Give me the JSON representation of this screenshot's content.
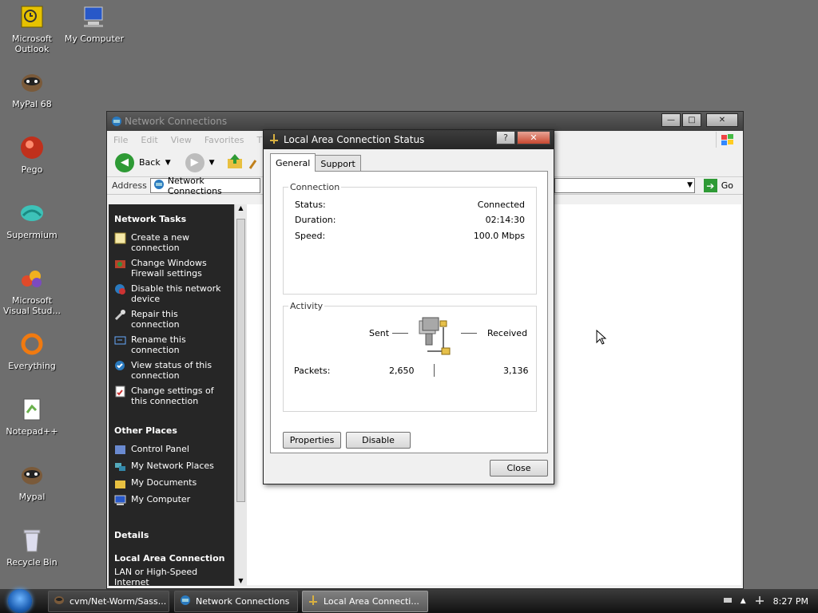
{
  "desktop": {
    "icons": [
      {
        "label": "Microsoft Outlook",
        "icon": "outlook-icon"
      },
      {
        "label": "My Computer",
        "icon": "my-computer-icon"
      },
      {
        "label": "MyPal 68",
        "icon": "mypal-icon"
      },
      {
        "label": "Pego",
        "icon": "pego-icon"
      },
      {
        "label": "Supermium",
        "icon": "supermium-icon"
      },
      {
        "label": "Microsoft Visual Stud...",
        "icon": "visual-studio-icon"
      },
      {
        "label": "Everything",
        "icon": "everything-icon"
      },
      {
        "label": "Notepad++",
        "icon": "notepadpp-icon"
      },
      {
        "label": "Mypal",
        "icon": "mypal-icon"
      },
      {
        "label": "Recycle Bin",
        "icon": "recycle-bin-icon"
      }
    ]
  },
  "nc_window": {
    "title": "Network Connections",
    "menu": [
      "File",
      "Edit",
      "View",
      "Favorites",
      "T"
    ],
    "toolbar": {
      "back": "Back"
    },
    "address": {
      "label": "Address",
      "value": "Network Connections",
      "go": "Go"
    },
    "tasks": {
      "heading": "Network Tasks",
      "items": [
        "Create a new connection",
        "Change Windows Firewall settings",
        "Disable this network device",
        "Repair this connection",
        "Rename this connection",
        "View status of this connection",
        "Change settings of this connection"
      ]
    },
    "other_places": {
      "heading": "Other Places",
      "items": [
        "Control Panel",
        "My Network Places",
        "My Documents",
        "My Computer"
      ]
    },
    "details": {
      "heading": "Details",
      "name": "Local Area Connection",
      "desc": "LAN or High-Speed Internet"
    }
  },
  "dialog": {
    "title": "Local Area Connection Status",
    "help_btn": "?",
    "close_btn": "✕",
    "tabs": [
      "General",
      "Support"
    ],
    "connection": {
      "heading": "Connection",
      "rows": [
        {
          "label": "Status:",
          "value": "Connected"
        },
        {
          "label": "Duration:",
          "value": "02:14:30"
        },
        {
          "label": "Speed:",
          "value": "100.0 Mbps"
        }
      ]
    },
    "activity": {
      "heading": "Activity",
      "sent_label": "Sent",
      "received_label": "Received",
      "packets_label": "Packets:",
      "sent_value": "2,650",
      "received_value": "3,136"
    },
    "buttons": {
      "properties": "Properties",
      "disable": "Disable",
      "close": "Close"
    }
  },
  "taskbar": {
    "items": [
      {
        "label": "cvm/Net-Worm/Sass..."
      },
      {
        "label": "Network Connections"
      },
      {
        "label": "Local Area Connecti..."
      }
    ],
    "clock": "8:27 PM"
  }
}
